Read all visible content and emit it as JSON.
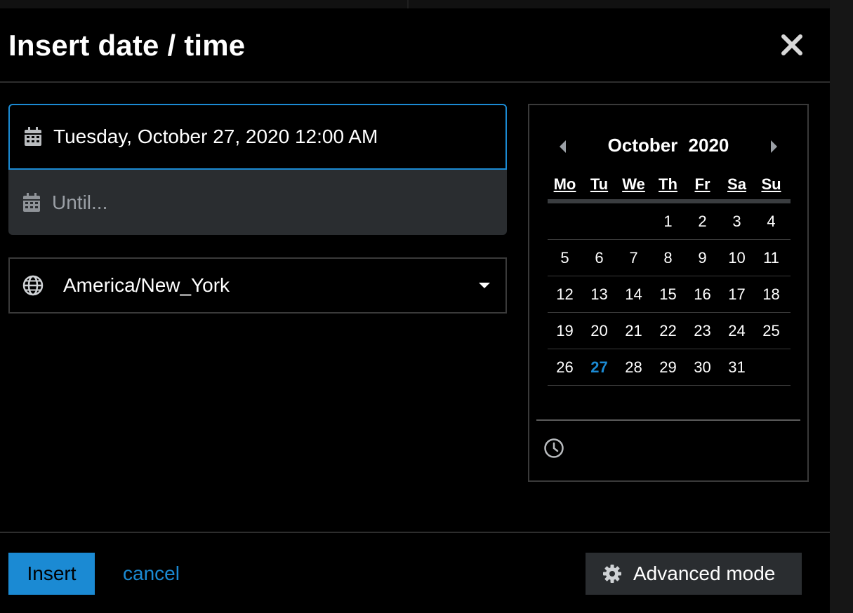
{
  "dialog": {
    "title": "Insert date / time"
  },
  "fields": {
    "start_value": "Tuesday, October 27, 2020 12:00 AM",
    "until_placeholder": "Until..."
  },
  "timezone": {
    "selected": "America/New_York"
  },
  "calendar": {
    "month": "October",
    "year": "2020",
    "weekdays": [
      "Mo",
      "Tu",
      "We",
      "Th",
      "Fr",
      "Sa",
      "Su"
    ],
    "weeks": [
      [
        "",
        "",
        "",
        "1",
        "2",
        "3",
        "4"
      ],
      [
        "5",
        "6",
        "7",
        "8",
        "9",
        "10",
        "11"
      ],
      [
        "12",
        "13",
        "14",
        "15",
        "16",
        "17",
        "18"
      ],
      [
        "19",
        "20",
        "21",
        "22",
        "23",
        "24",
        "25"
      ],
      [
        "26",
        "27",
        "28",
        "29",
        "30",
        "31",
        ""
      ]
    ],
    "selected_day": "27"
  },
  "footer": {
    "insert_label": "Insert",
    "cancel_label": "cancel",
    "advanced_label": "Advanced mode"
  },
  "icons": {
    "close": "close-icon",
    "calendar": "calendar-icon",
    "globe": "globe-icon",
    "caret": "caret-down-icon",
    "prev": "chevron-left-icon",
    "next": "chevron-right-icon",
    "clock": "clock-icon",
    "gear": "gear-icon"
  },
  "colors": {
    "accent": "#1b8ad3",
    "background": "#000000",
    "field_disabled": "#2a2d30"
  }
}
